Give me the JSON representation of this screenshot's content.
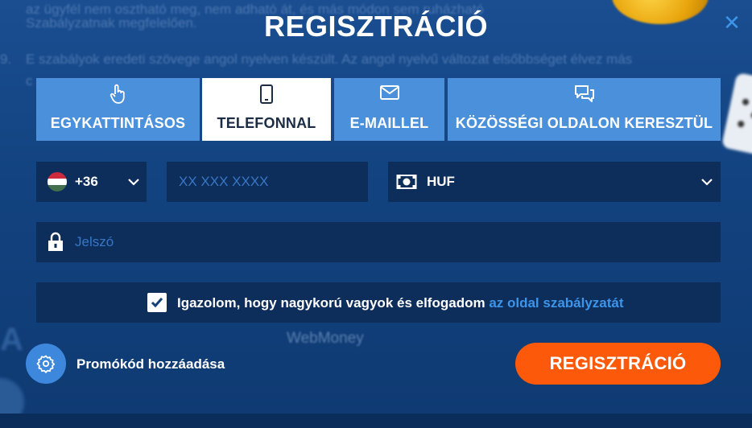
{
  "modal": {
    "title": "REGISZTRÁCIÓ",
    "close_icon": "close-icon"
  },
  "background": {
    "lines": [
      "az ügyfél nem osztható meg, nem adható át, és más módon sem ruházható",
      "Szabályzatnak megfelelően.",
      "E szabályok eredeti szövege angol nyelven készült. Az angol nyelvű változat elsőbbséget élvez más",
      "c"
    ],
    "item_number": "9.",
    "payment_logo": "WebMoney"
  },
  "tabs": [
    {
      "label": "EGYKATTINTÁSOS",
      "icon": "pointer-hand-icon",
      "active": false
    },
    {
      "label": "TELEFONNAL",
      "icon": "smartphone-icon",
      "active": true
    },
    {
      "label": "E-MAILLEL",
      "icon": "envelope-icon",
      "active": false
    },
    {
      "label": "KÖZÖSSÉGI OLDALON KERESZTÜL",
      "icon": "chat-bubbles-icon",
      "active": false
    }
  ],
  "country": {
    "code": "+36",
    "flag": "hungary-flag-icon",
    "flag_colors": [
      "#cd2a3e",
      "#ffffff",
      "#436f4d"
    ]
  },
  "phone": {
    "placeholder": "XX XXX XXXX",
    "value": ""
  },
  "currency": {
    "value": "HUF",
    "icon": "banknote-icon"
  },
  "password": {
    "placeholder": "Jelszó",
    "icon": "lock-icon"
  },
  "agreement": {
    "checked": true,
    "text": "Igazolom, hogy nagykorú vagyok és elfogadom ",
    "link": "az oldal szabályzatát"
  },
  "promo": {
    "label": "Promókód hozzáadása",
    "icon": "gear-icon"
  },
  "submit": {
    "label": "REGISZTRÁCIÓ"
  },
  "colors": {
    "accent_blue": "#3d95ea",
    "tab_blue": "#4b90da",
    "field_bg": "#0d2d5a",
    "submit_orange": "#fc5a0a"
  }
}
